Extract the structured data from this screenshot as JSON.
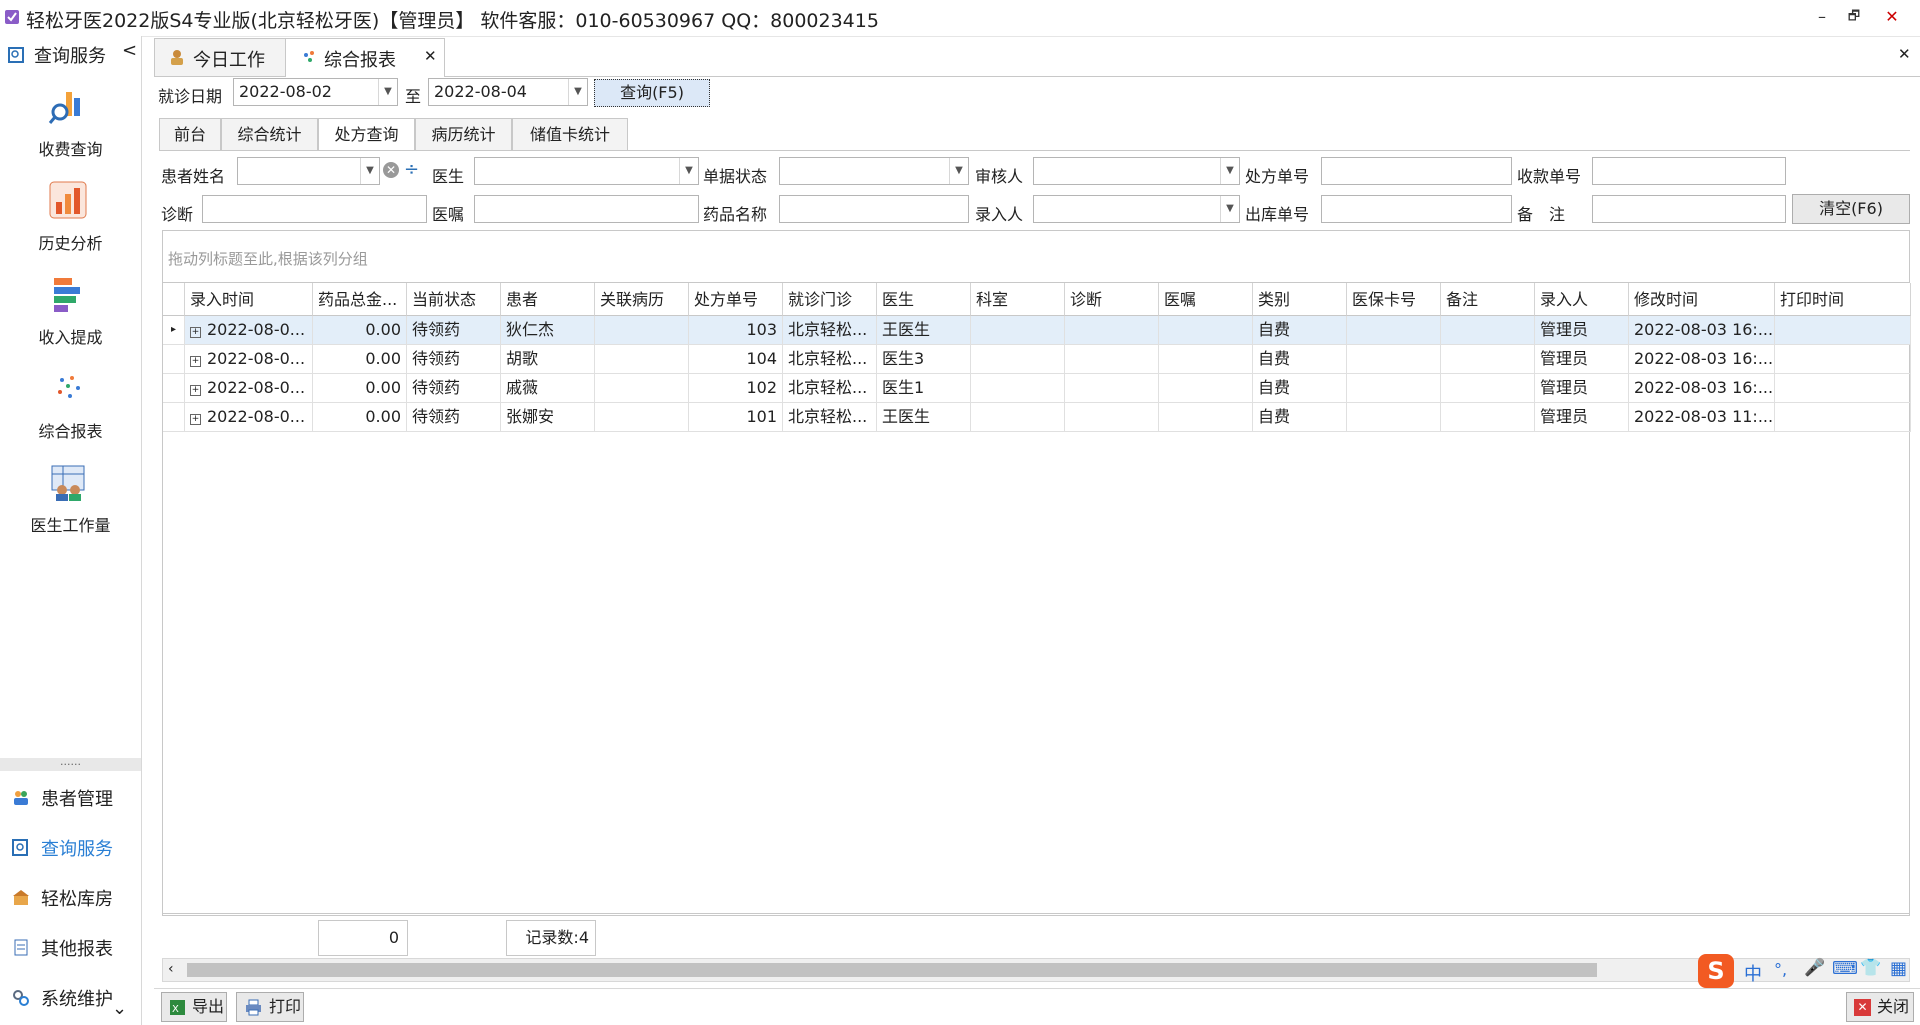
{
  "window": {
    "title": "轻松牙医2022版S4专业版(北京轻松牙医)【管理员】   软件客服：010-60530967 QQ：800023415",
    "minimize": "–",
    "restore": "🗗",
    "close": "✕"
  },
  "sidebar": {
    "header": "查询服务",
    "collapse": "<",
    "items": [
      {
        "label": "收费查询",
        "icon": "search-chart-icon"
      },
      {
        "label": "历史分析",
        "icon": "bar-chart-icon"
      },
      {
        "label": "收入提成",
        "icon": "stacked-bars-icon"
      },
      {
        "label": "综合报表",
        "icon": "dots-icon"
      },
      {
        "label": "医生工作量",
        "icon": "doctor-workload-icon"
      }
    ],
    "splitter": "......",
    "nav": [
      {
        "label": "患者管理",
        "icon": "patients-icon"
      },
      {
        "label": "查询服务",
        "icon": "query-icon",
        "active": true
      },
      {
        "label": "轻松库房",
        "icon": "warehouse-icon"
      },
      {
        "label": "其他报表",
        "icon": "reports-icon"
      },
      {
        "label": "系统维护",
        "icon": "settings-icon"
      }
    ],
    "more": "⌄"
  },
  "tabs": {
    "items": [
      "今日工作",
      "综合报表"
    ],
    "close_tab": "✕",
    "close_all": "✕"
  },
  "filters": {
    "date_label": "就诊日期",
    "date_from": "2022-08-02",
    "to_label": "至",
    "date_to": "2022-08-04",
    "query_button": "查询(F5)"
  },
  "subtabs": [
    "前台",
    "综合统计",
    "处方查询",
    "病历统计",
    "储值卡统计"
  ],
  "form": {
    "patient_name": "患者姓名",
    "doctor": "医生",
    "bill_status": "单据状态",
    "reviewer": "审核人",
    "rx_no": "处方单号",
    "receipt_no": "收款单号",
    "diagnosis": "诊断",
    "advice": "医嘱",
    "drug_name": "药品名称",
    "entered_by": "录入人",
    "outbound_no": "出库单号",
    "remark": "备　注",
    "clear_button": "清空(F6)"
  },
  "grid": {
    "group_hint": "拖动列标题至此,根据该列分组",
    "columns": [
      "录入时间",
      "药品总金...",
      "当前状态",
      "患者",
      "关联病历",
      "处方单号",
      "就诊门诊",
      "医生",
      "科室",
      "诊断",
      "医嘱",
      "类别",
      "医保卡号",
      "备注",
      "录入人",
      "修改时间",
      "打印时间"
    ],
    "rows": [
      {
        "time": "2022-08-0...",
        "amount": "0.00",
        "status": "待领药",
        "patient": "狄仁杰",
        "record": "",
        "rx": "103",
        "clinic": "北京轻松...",
        "doctor": "王医生",
        "dept": "",
        "diag": "",
        "advice": "",
        "type": "自费",
        "card": "",
        "note": "",
        "entered": "管理员",
        "modified": "2022-08-03 16:...",
        "printed": ""
      },
      {
        "time": "2022-08-0...",
        "amount": "0.00",
        "status": "待领药",
        "patient": "胡歌",
        "record": "",
        "rx": "104",
        "clinic": "北京轻松...",
        "doctor": "医生3",
        "dept": "",
        "diag": "",
        "advice": "",
        "type": "自费",
        "card": "",
        "note": "",
        "entered": "管理员",
        "modified": "2022-08-03 16:...",
        "printed": ""
      },
      {
        "time": "2022-08-0...",
        "amount": "0.00",
        "status": "待领药",
        "patient": "戚薇",
        "record": "",
        "rx": "102",
        "clinic": "北京轻松...",
        "doctor": "医生1",
        "dept": "",
        "diag": "",
        "advice": "",
        "type": "自费",
        "card": "",
        "note": "",
        "entered": "管理员",
        "modified": "2022-08-03 16:...",
        "printed": ""
      },
      {
        "time": "2022-08-0...",
        "amount": "0.00",
        "status": "待领药",
        "patient": "张娜安",
        "record": "",
        "rx": "101",
        "clinic": "北京轻松...",
        "doctor": "王医生",
        "dept": "",
        "diag": "",
        "advice": "",
        "type": "自费",
        "card": "",
        "note": "",
        "entered": "管理员",
        "modified": "2022-08-03 11:...",
        "printed": ""
      }
    ],
    "footer_total": "0",
    "footer_count": "记录数:4"
  },
  "bottom": {
    "export": "导出",
    "print": "打印",
    "close": "关闭"
  },
  "ime": [
    "中",
    "°,",
    "🎤",
    "⌨",
    "👕",
    "▦"
  ],
  "colors": {
    "accent": "#2a7fd4",
    "selected_row": "#e3eef9",
    "ime_logo": "#f25a22"
  }
}
